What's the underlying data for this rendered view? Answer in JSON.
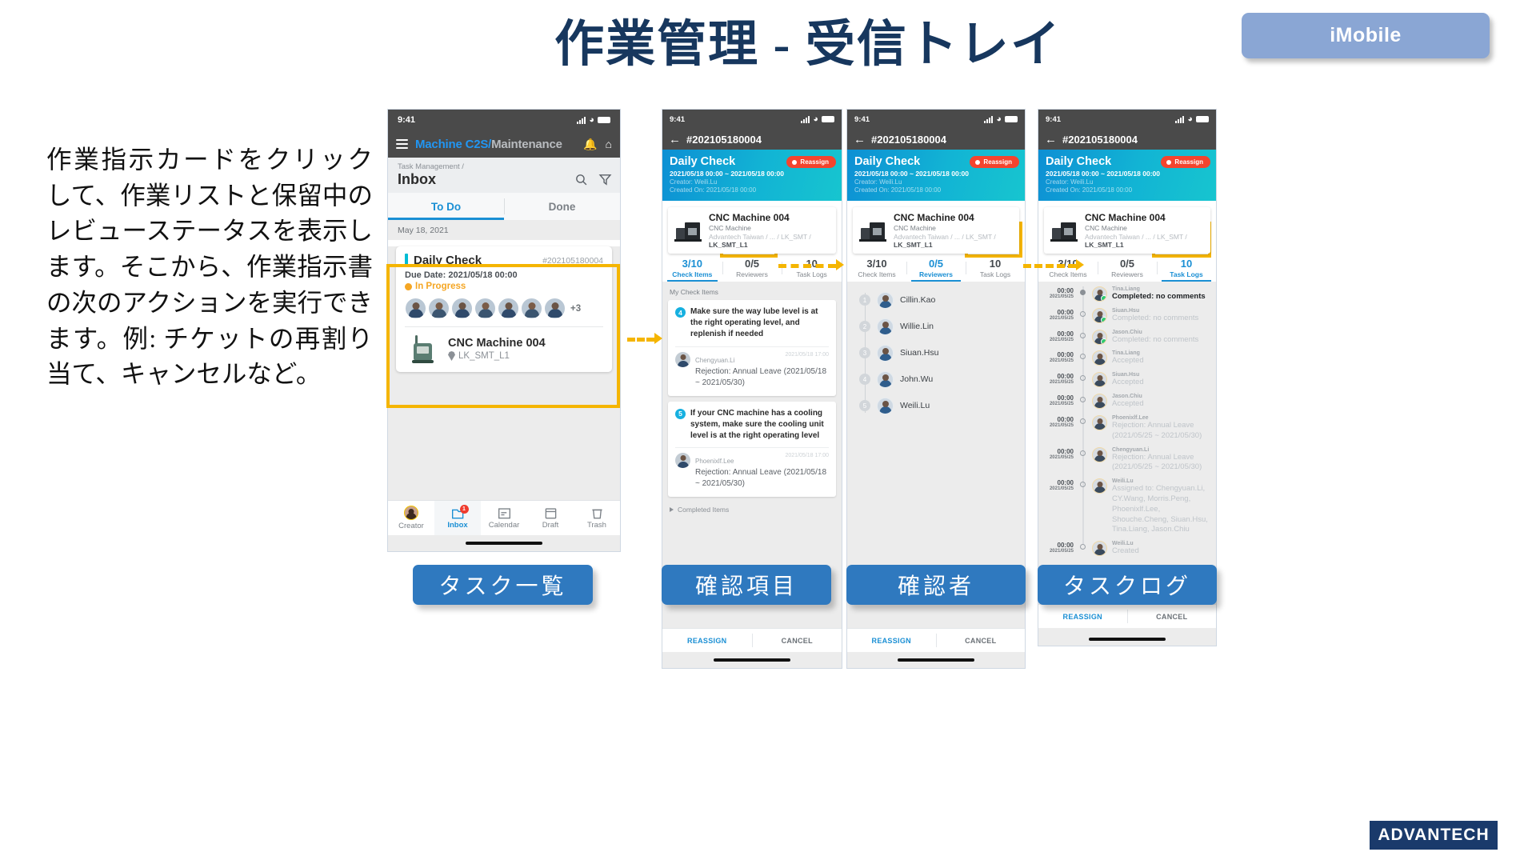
{
  "header": {
    "title": "作業管理 - 受信トレイ",
    "badge": "iMobile"
  },
  "description": "作業指示カードをクリックして、作業リストと保留中のレビューステータスを表示します。そこから、作業指示書の次のアクションを実行できます。例: チケットの再割り当て、キャンセルなど。",
  "brand": {
    "name_left": "ADV",
    "name_accent": "A",
    "name_right": "NTECH",
    "full": "ADVANTECH"
  },
  "captions": {
    "one": "タスク一覧",
    "two": "確認項目",
    "three": "確認者",
    "four": "タスクログ"
  },
  "phone1": {
    "status_time": "9:41",
    "app_title_blue": "Machine C2S/",
    "app_title_gray": "Maintenance",
    "breadcrumb": "Task Management /",
    "page_title": "Inbox",
    "tabs": [
      {
        "label": "To Do",
        "active": true
      },
      {
        "label": "Done",
        "active": false
      }
    ],
    "date_header": "May 18, 2021",
    "task_card": {
      "title": "Daily Check",
      "number": "#202105180004",
      "due": "Due Date: 2021/05/18 00:00",
      "status": "In Progress",
      "avatar_overflow": "+3",
      "machine_name": "CNC Machine 004",
      "machine_location": "LK_SMT_L1"
    },
    "fab": "+",
    "bottom_nav": [
      {
        "label": "Creator",
        "active": false,
        "badge": ""
      },
      {
        "label": "Inbox",
        "active": true,
        "badge": "1"
      },
      {
        "label": "Calendar",
        "active": false,
        "badge": ""
      },
      {
        "label": "Draft",
        "active": false,
        "badge": ""
      },
      {
        "label": "Trash",
        "active": false,
        "badge": ""
      }
    ]
  },
  "detail_common": {
    "status_time": "9:41",
    "ticket_id": "#202105180004",
    "hero_title": "Daily Check",
    "hero_range": "2021/05/18 00:00 ~ 2021/05/18 00:00",
    "hero_creator": "Creator: Weili.Lu",
    "hero_created": "Created On: 2021/05/18 00:00",
    "reassign_pill": "Reassign",
    "machine_name": "CNC Machine 004",
    "machine_type": "CNC Machine",
    "machine_path_dim": "Advantech Taiwan / ... / LK_SMT / ",
    "machine_path_bold": "LK_SMT_L1",
    "stats": [
      {
        "value": "3/10",
        "label": "Check Items"
      },
      {
        "value": "0/5",
        "label": "Reviewers"
      },
      {
        "value": "10",
        "label": "Task Logs"
      }
    ],
    "actions": {
      "primary": "REASSIGN",
      "secondary": "CANCEL"
    }
  },
  "phone2": {
    "active_stat": 0,
    "section_label": "My Check Items",
    "check_items": [
      {
        "number": "4",
        "text": "Make sure the way lube level is at the right operating level, and replenish if needed",
        "comment_author": "Chengyuan.Li",
        "comment_time": "2021/05/18 17:00",
        "comment_text": "Rejection: Annual Leave (2021/05/18 ~ 2021/05/30)"
      },
      {
        "number": "5",
        "text": "If your CNC machine has a cooling system, make sure the cooling unit level is at the right operating level",
        "comment_author": "Phoenixlf.Lee",
        "comment_time": "2021/05/18 17:00",
        "comment_text": "Rejection: Annual Leave (2021/05/18 ~ 2021/05/30)"
      }
    ],
    "completed_toggle": "Completed Items"
  },
  "phone3": {
    "active_stat": 1,
    "reviewers": [
      {
        "num": "1",
        "name": "Cillin.Kao"
      },
      {
        "num": "2",
        "name": "Willie.Lin"
      },
      {
        "num": "3",
        "name": "Siuan.Hsu"
      },
      {
        "num": "4",
        "name": "John.Wu"
      },
      {
        "num": "5",
        "name": "Weili.Lu"
      }
    ]
  },
  "phone4": {
    "active_stat": 2,
    "logs": [
      {
        "time": "00:00",
        "date": "2021/05/25",
        "who": "Tina.Liang",
        "msg": "Completed: no comments",
        "state": "active",
        "check": true
      },
      {
        "time": "00:00",
        "date": "2021/05/25",
        "who": "Siuan.Hsu",
        "msg": "Completed: no comments",
        "state": "dim",
        "check": true
      },
      {
        "time": "00:00",
        "date": "2021/05/25",
        "who": "Jason.Chiu",
        "msg": "Completed: no comments",
        "state": "dim",
        "check": true
      },
      {
        "time": "00:00",
        "date": "2021/05/25",
        "who": "Tina.Liang",
        "msg": "Accepted",
        "state": "dim",
        "check": false
      },
      {
        "time": "00:00",
        "date": "2021/05/25",
        "who": "Siuan.Hsu",
        "msg": "Accepted",
        "state": "dim",
        "check": false
      },
      {
        "time": "00:00",
        "date": "2021/05/25",
        "who": "Jason.Chiu",
        "msg": "Accepted",
        "state": "dim",
        "check": false
      },
      {
        "time": "00:00",
        "date": "2021/05/25",
        "who": "Phoenixlf.Lee",
        "msg": "Rejection: Annual Leave (2021/05/25 ~ 2021/05/30)",
        "state": "dim",
        "check": false
      },
      {
        "time": "00:00",
        "date": "2021/05/25",
        "who": "Chengyuan.Li",
        "msg": "Rejection: Annual Leave (2021/05/25 ~ 2021/05/30)",
        "state": "dim",
        "check": false
      },
      {
        "time": "00:00",
        "date": "2021/05/25",
        "who": "Weili.Lu",
        "msg": "Assigned to: Chengyuan.Li, CY.Wang, Morris.Peng, Phoenixlf.Lee, Shouche.Cheng, Siuan.Hsu, Tina.Liang, Jason.Chiu",
        "state": "dim",
        "check": false
      },
      {
        "time": "00:00",
        "date": "2021/05/25",
        "who": "Weili.Lu",
        "msg": "Created",
        "state": "dim",
        "check": false
      }
    ]
  },
  "colors": {
    "title_navy": "#17375e",
    "badge_blue": "#8aa6d4",
    "highlight_yellow": "#f5b500",
    "accent_blue": "#1a8fd4",
    "hero_cyan": "#12b4d4",
    "reassign_red": "#f4442e",
    "caption_blue": "#2f79bf",
    "status_orange": "#f5a623",
    "fab_indigo": "#3f51e0"
  }
}
